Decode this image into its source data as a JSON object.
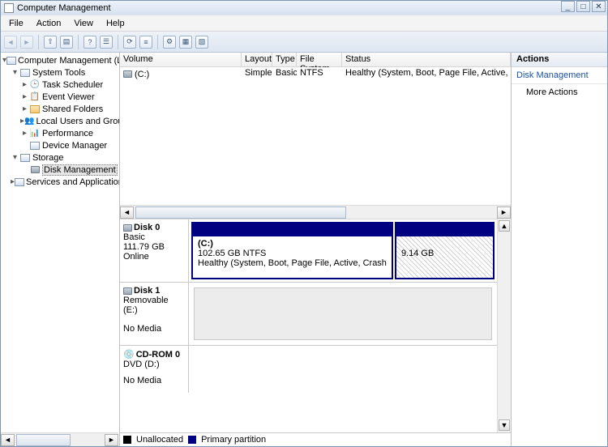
{
  "window": {
    "title": "Computer Management"
  },
  "menu": {
    "file": "File",
    "action": "Action",
    "view": "View",
    "help": "Help"
  },
  "tree": {
    "root": "Computer Management (Local",
    "systools": "System Tools",
    "tasksched": "Task Scheduler",
    "eventviewer": "Event Viewer",
    "sharedfolders": "Shared Folders",
    "localusers": "Local Users and Groups",
    "performance": "Performance",
    "devicemgr": "Device Manager",
    "storage": "Storage",
    "diskmgmt": "Disk Management",
    "services": "Services and Applications"
  },
  "vol_headers": {
    "volume": "Volume",
    "layout": "Layout",
    "type": "Type",
    "fs": "File System",
    "status": "Status"
  },
  "vol_row": {
    "volume": "(C:)",
    "layout": "Simple",
    "type": "Basic",
    "fs": "NTFS",
    "status": "Healthy (System, Boot, Page File, Active, Crash"
  },
  "disk0": {
    "name": "Disk 0",
    "kind": "Basic",
    "size": "111.79 GB",
    "state": "Online",
    "p1_label": "(C:)",
    "p1_line2": "102.65 GB NTFS",
    "p1_line3": "Healthy (System, Boot, Page File, Active, Crash",
    "p2_size": "9.14 GB"
  },
  "disk1": {
    "name": "Disk 1",
    "kind": "Removable (E:)",
    "nomedia": "No Media"
  },
  "cdrom": {
    "name": "CD-ROM 0",
    "kind": "DVD (D:)",
    "nomedia": "No Media"
  },
  "legend": {
    "unallocated": "Unallocated",
    "primary": "Primary partition"
  },
  "actions": {
    "header": "Actions",
    "group": "Disk Management",
    "more": "More Actions"
  }
}
